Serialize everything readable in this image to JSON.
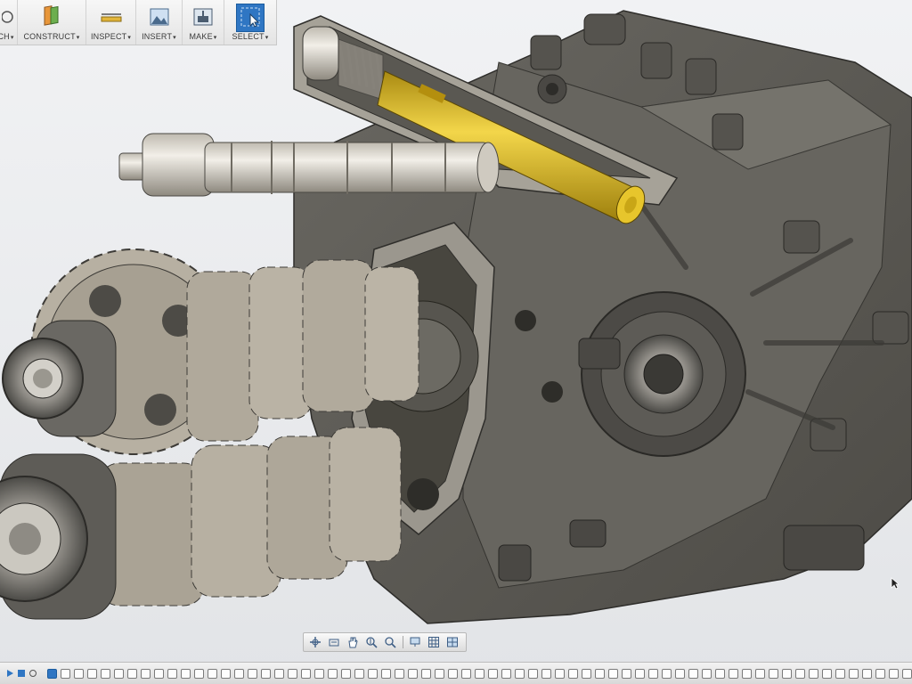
{
  "toolbar": {
    "groups": [
      {
        "label": "CH",
        "icon": "sketch-icon"
      },
      {
        "label": "CONSTRUCT",
        "icon": "construct-plane-icon"
      },
      {
        "label": "INSPECT",
        "icon": "measure-icon"
      },
      {
        "label": "INSERT",
        "icon": "insert-image-icon"
      },
      {
        "label": "MAKE",
        "icon": "make-3d-print-icon"
      },
      {
        "label": "SELECT",
        "icon": "select-cursor-icon"
      }
    ],
    "caret": "▾"
  },
  "navbar": {
    "buttons": [
      "orbit-icon",
      "look-at-icon",
      "pan-icon",
      "zoom-window-icon",
      "fit-icon",
      "display-settings-icon",
      "grid-icon",
      "viewports-icon"
    ]
  },
  "timeline": {
    "step_count": 68,
    "active_step": 0
  },
  "colors": {
    "accent": "#2f76c3",
    "housing": "#5f5d58",
    "gear": "#b8b1a3",
    "shaft": "#d6d1c5",
    "shift_rod": "#d9b21c",
    "background": "#e9ebee"
  }
}
